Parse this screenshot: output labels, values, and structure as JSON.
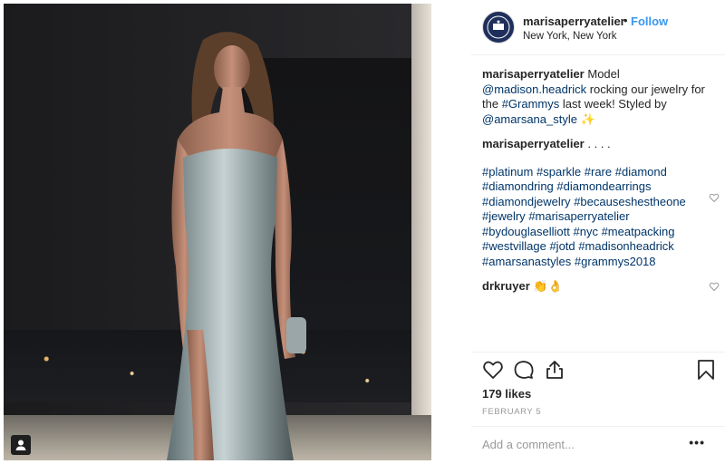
{
  "header": {
    "username": "marisaperryatelier",
    "separator": "•",
    "follow_label": "Follow",
    "location": "New York, New York"
  },
  "caption": {
    "username": "marisaperryatelier",
    "text_1": "Model",
    "mention_1": "@madison.headrick",
    "text_2": "rocking our jewelry for the",
    "hashtag_1": "#Grammys",
    "text_3": "last week! Styled by",
    "mention_2": "@amarsana_style",
    "sparkle": "✨"
  },
  "comments": [
    {
      "username": "marisaperryatelier",
      "text": ". . . .",
      "hashtags": [
        "#platinum",
        "#sparkle",
        "#rare",
        "#diamond",
        "#diamondring",
        "#diamondearrings",
        "#diamondjewelry",
        "#becauseshestheone",
        "#jewelry",
        "#marisaperryatelier",
        "#bydouglaselliott",
        "#nyc",
        "#meatpacking",
        "#westvillage",
        "#jotd",
        "#madisonheadrick",
        "#amarsanastyles",
        "#grammys2018"
      ]
    },
    {
      "username": "drkruyer",
      "text": "👏👌"
    }
  ],
  "likes": "179 likes",
  "date": "FEBRUARY 5",
  "comment_placeholder": "Add a comment...",
  "more_label": "•••",
  "icons": {
    "like": "heart-icon",
    "comment": "comment-icon",
    "share": "share-icon",
    "save": "bookmark-icon",
    "tagged": "user-tag-icon"
  },
  "colors": {
    "link": "#003569",
    "follow": "#3897f0",
    "muted": "#999999"
  }
}
